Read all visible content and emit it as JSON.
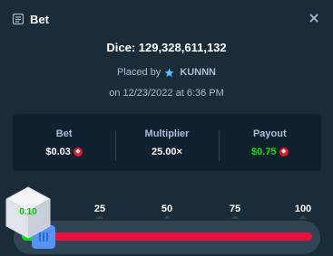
{
  "header": {
    "title": "Bet",
    "icon": "bet-slip-icon",
    "close_icon": "close-icon"
  },
  "bet": {
    "title": "Dice: 129,328,611,132",
    "placed_by_label": "Placed by",
    "user": "KUNNN",
    "user_icon": "star-icon",
    "date": "on 12/23/2022 at 6:36 PM"
  },
  "stats": {
    "bet_label": "Bet",
    "bet_value": "$0.03",
    "multiplier_label": "Multiplier",
    "multiplier_value": "25.00×",
    "payout_label": "Payout",
    "payout_value": "$0.75",
    "currency_icon": "currency-coin-icon"
  },
  "slider": {
    "ticks": [
      "0",
      "25",
      "50",
      "75",
      "100"
    ],
    "roll_result": "0.10",
    "win_fraction": 0.04
  },
  "colors": {
    "background": "#1a2c38",
    "panel": "#0f212e",
    "win": "#00e701",
    "lose": "#e9113c",
    "handle": "#5593f7"
  }
}
